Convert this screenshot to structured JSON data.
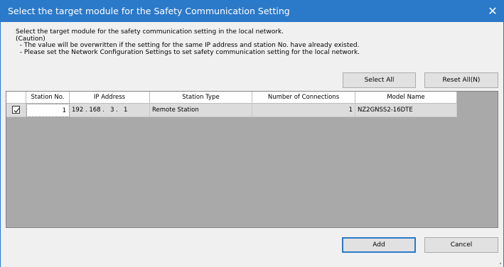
{
  "window": {
    "title": "Select the target module for the Safety Communication Setting",
    "close_symbol": "✕"
  },
  "description": {
    "lines": [
      "Select the target module for the safety communication setting in the local network.",
      "(Caution)",
      "  - The value will be overwritten if the setting for the same IP address and station No. have already existed.",
      "  - Please set the Network Configuration Settings to set safety communication setting for the local network."
    ]
  },
  "toolbar": {
    "select_all_label": "Select All",
    "reset_all_label": "Reset All(N)"
  },
  "table": {
    "headers": {
      "check": "",
      "station_no": "Station No.",
      "ip": "IP Address",
      "station_type": "Station Type",
      "connections": "Number of Connections",
      "model": "Model Name"
    },
    "rows": [
      {
        "checked": true,
        "station_no": "1",
        "ip": "192 . 168 .   3 .   1",
        "station_type": "Remote Station",
        "connections": "1",
        "model": "NZ2GNSS2-16DTE"
      }
    ]
  },
  "footer": {
    "add_label": "Add",
    "cancel_label": "Cancel"
  },
  "colors": {
    "titlebar": "#2b79c9",
    "grid_bg": "#a9a9aa",
    "dialog_bg": "#f0f0f0"
  }
}
